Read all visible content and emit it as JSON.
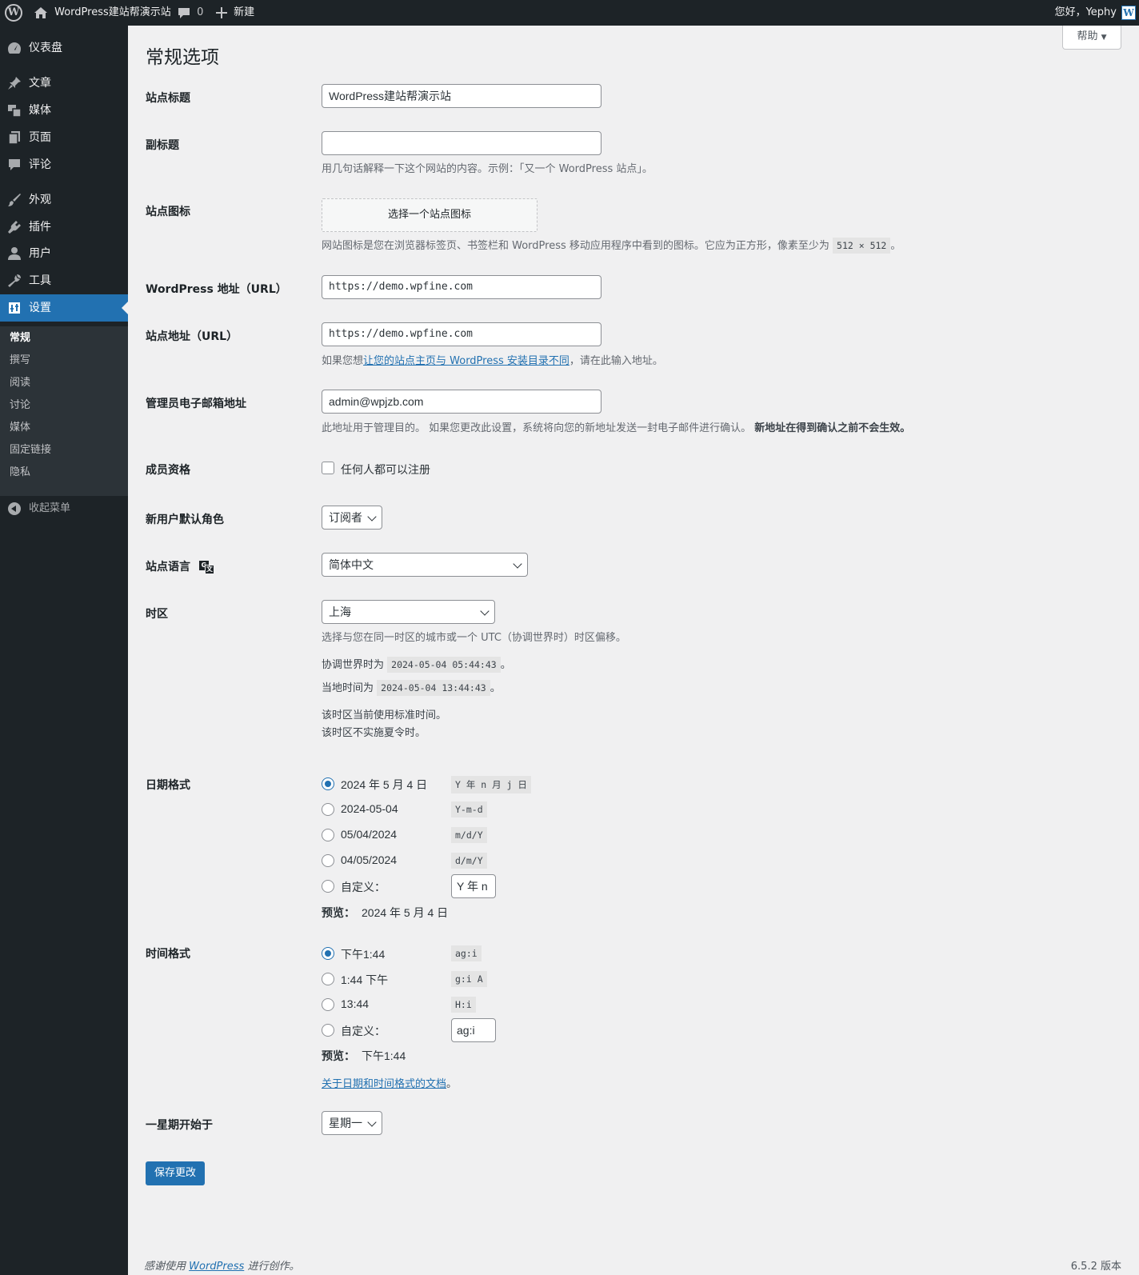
{
  "adminbar": {
    "site_name": "WordPress建站帮演示站",
    "comments_count": "0",
    "new_label": "新建",
    "greeting": "您好，Yephy"
  },
  "sidebar": {
    "items": [
      {
        "label": "仪表盘",
        "icon": "dashboard-icon"
      },
      {
        "label": "文章",
        "icon": "pin-icon"
      },
      {
        "label": "媒体",
        "icon": "media-icon"
      },
      {
        "label": "页面",
        "icon": "page-icon"
      },
      {
        "label": "评论",
        "icon": "comment-icon"
      },
      {
        "label": "外观",
        "icon": "brush-icon"
      },
      {
        "label": "插件",
        "icon": "plugin-icon"
      },
      {
        "label": "用户",
        "icon": "user-icon"
      },
      {
        "label": "工具",
        "icon": "wrench-icon"
      },
      {
        "label": "设置",
        "icon": "settings-icon"
      }
    ],
    "submenu": [
      "常规",
      "撰写",
      "阅读",
      "讨论",
      "媒体",
      "固定链接",
      "隐私"
    ],
    "collapse_label": "收起菜单"
  },
  "help_label": "帮助",
  "page_title": "常规选项",
  "site_title": {
    "label": "站点标题",
    "value": "WordPress建站帮演示站"
  },
  "tagline": {
    "label": "副标题",
    "value": "",
    "description": "用几句话解释一下这个网站的内容。示例：「又一个 WordPress 站点」。"
  },
  "site_icon": {
    "label": "站点图标",
    "button": "选择一个站点图标",
    "description_before": "网站图标是您在浏览器标签页、书签栏和 WordPress 移动应用程序中看到的图标。它应为正方形，像素至少为",
    "size_code": "512 × 512",
    "description_after": "。"
  },
  "wp_url": {
    "label": "WordPress 地址（URL）",
    "value": "https://demo.wpfine.com"
  },
  "site_url": {
    "label": "站点地址（URL）",
    "value": "https://demo.wpfine.com",
    "desc_before": "如果您想",
    "desc_link": "让您的站点主页与 WordPress 安装目录不同",
    "desc_after": "，请在此输入地址。"
  },
  "admin_email": {
    "label": "管理员电子邮箱地址",
    "value": "admin@wpjzb.com",
    "desc": "此地址用于管理目的。 如果您更改此设置，系统将向您的新地址发送一封电子邮件进行确认。",
    "desc_bold": "新地址在得到确认之前不会生效。"
  },
  "membership": {
    "label": "成员资格",
    "checkbox_label": "任何人都可以注册"
  },
  "default_role": {
    "label": "新用户默认角色",
    "value": "订阅者"
  },
  "site_language": {
    "label": "站点语言",
    "value": "简体中文"
  },
  "timezone": {
    "label": "时区",
    "value": "上海",
    "desc": "选择与您在同一时区的城市或一个 UTC（协调世界时）时区偏移。",
    "utc_label": "协调世界时为",
    "utc_time": "2024-05-04 05:44:43",
    "local_label": "当地时间为",
    "local_time": "2024-05-04 13:44:43",
    "period": "。",
    "note1": "该时区当前使用标准时间。",
    "note2": "该时区不实施夏令时。"
  },
  "date_format": {
    "label": "日期格式",
    "options": [
      {
        "label": "2024 年 5 月 4 日",
        "code": "Y 年 n 月 j 日",
        "checked": true
      },
      {
        "label": "2024-05-04",
        "code": "Y-m-d",
        "checked": false
      },
      {
        "label": "05/04/2024",
        "code": "m/d/Y",
        "checked": false
      },
      {
        "label": "04/05/2024",
        "code": "d/m/Y",
        "checked": false
      }
    ],
    "custom_label": "自定义：",
    "custom_value": "Y 年 n",
    "preview_label": "预览：",
    "preview_value": "2024 年 5 月 4 日"
  },
  "time_format": {
    "label": "时间格式",
    "options": [
      {
        "label": "下午1:44",
        "code": "ag:i",
        "checked": true
      },
      {
        "label": "1:44 下午",
        "code": "g:i A",
        "checked": false
      },
      {
        "label": "13:44",
        "code": "H:i",
        "checked": false
      }
    ],
    "custom_label": "自定义：",
    "custom_value": "ag:i",
    "preview_label": "预览：",
    "preview_value": "下午1:44",
    "doc_link": "关于日期和时间格式的文档",
    "doc_after": "。"
  },
  "start_of_week": {
    "label": "一星期开始于",
    "value": "星期一"
  },
  "save_button": "保存更改",
  "footer": {
    "thanks_before": "感谢使用",
    "thanks_link": "WordPress",
    "thanks_after": "进行创作。",
    "version": "6.5.2 版本"
  },
  "colors": {
    "accent": "#2271b1",
    "adminbar": "#1d2327",
    "background": "#f0f0f1"
  }
}
